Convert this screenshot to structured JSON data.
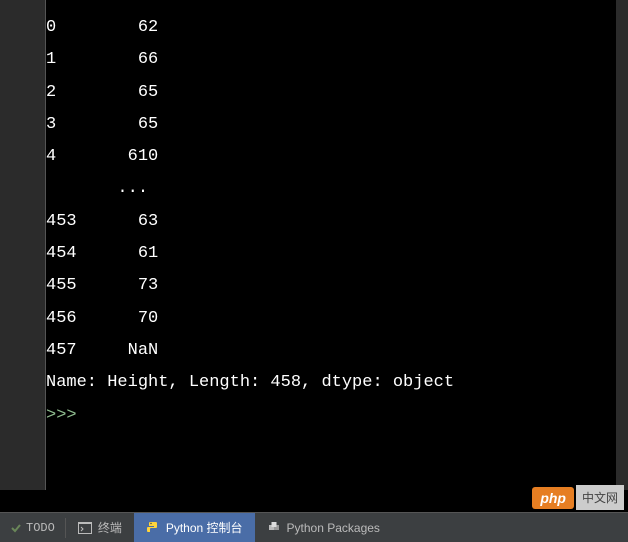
{
  "console": {
    "rows": [
      {
        "index": "0",
        "value": "62"
      },
      {
        "index": "1",
        "value": "66"
      },
      {
        "index": "2",
        "value": "65"
      },
      {
        "index": "3",
        "value": "65"
      },
      {
        "index": "4",
        "value": "610"
      },
      {
        "index": "",
        "value": "... "
      },
      {
        "index": "453",
        "value": "63"
      },
      {
        "index": "454",
        "value": "61"
      },
      {
        "index": "455",
        "value": "73"
      },
      {
        "index": "456",
        "value": "70"
      },
      {
        "index": "457",
        "value": "NaN"
      }
    ],
    "summary": "Name: Height, Length: 458, dtype: object",
    "prompt": ">>> "
  },
  "tabs": {
    "todo": "TODO",
    "terminal": "终端",
    "python_console": "Python 控制台",
    "python_packages": "Python Packages"
  },
  "branding": {
    "php": "php",
    "cn": "中文网"
  },
  "chart_data": {
    "type": "table",
    "title": "Pandas Series Output",
    "column_name": "Height",
    "length": 458,
    "dtype": "object",
    "visible_rows": [
      {
        "index": 0,
        "value": "62"
      },
      {
        "index": 1,
        "value": "66"
      },
      {
        "index": 2,
        "value": "65"
      },
      {
        "index": 3,
        "value": "65"
      },
      {
        "index": 4,
        "value": "610"
      },
      {
        "index": 453,
        "value": "63"
      },
      {
        "index": 454,
        "value": "61"
      },
      {
        "index": 455,
        "value": "73"
      },
      {
        "index": 456,
        "value": "70"
      },
      {
        "index": 457,
        "value": "NaN"
      }
    ]
  }
}
